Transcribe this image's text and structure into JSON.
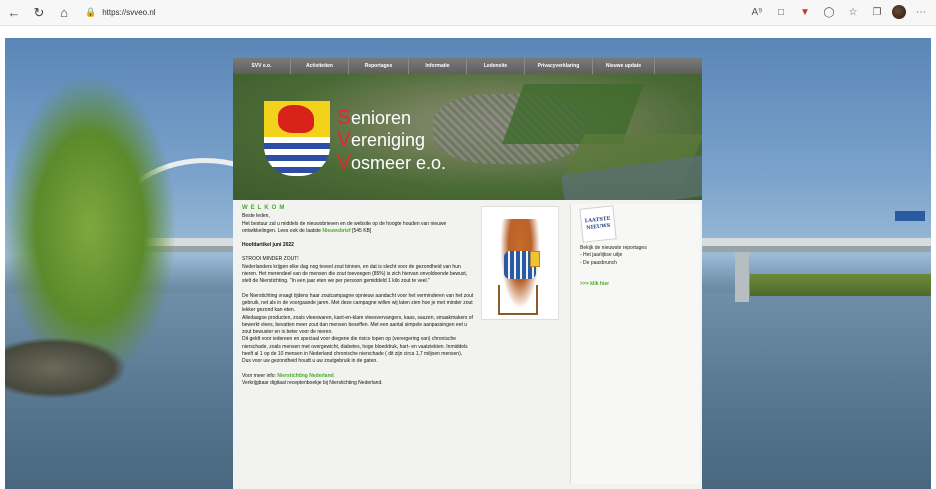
{
  "browser": {
    "url": "https://svveo.nl",
    "icons": [
      "back-icon",
      "refresh-icon",
      "home-icon",
      "lock-icon",
      "read-aloud-icon",
      "tab-icon",
      "extension-icon",
      "circle-icon",
      "favorites-icon",
      "collections-icon",
      "avatar",
      "more-icon"
    ]
  },
  "nav": {
    "items": [
      "SVV e.o.",
      "Activiteiten",
      "Reportages",
      "Informatie",
      "Ledensite",
      "Privacyverklaring",
      "Nieuwe update"
    ]
  },
  "banner": {
    "line1_initial": "S",
    "line1_rest": "enioren",
    "line2_initial": "V",
    "line2_rest": "ereniging",
    "line3_initial": "V",
    "line3_rest": "osmeer e.o."
  },
  "main": {
    "welkom": "WELKOM",
    "p1": "Beste leden,",
    "p2a": "Het bestuur zal u middels de nieuwsbrieven en de website op de hoogte houden van nieuwe ontwikkelingen. Lees ook de laatste ",
    "p2_link": "Nieuwsbrief",
    "p2b": " [545 KB]",
    "heading": "Hoofdartikel juni 2022",
    "sub": "STROOI MINDER ZOUT!",
    "p3": "Nederlanders krijgen elke dag nog teveel zout binnen, en dat is slecht voor de gezondheid van hun nieren. Het merendeel van de mensen die zout toevoegen (85%) is zich hiervan onvoldoende bewust, stelt de Nierstichting. \"In een jaar eten we per persoon gemiddeld 1 kilo zout te veel.\"",
    "p4": "De Nierstichting vraagt tijdens haar zoutcampagne opnieuw aandacht voor het verminderen van het zout gebruik, net als in de voorgaande jaren. Met deze campagne willen wij laten zien hoe je met minder zout lekker gezond kan eten.",
    "p5": "Alledaagse producten, zoals vleeswaren, kant-en-klare vleesvervangers, kaas, sauzen, smaakmakers of bewerkt vlees, bevatten meer zout dan mensen beseffen. Met een aantal simpele aanpassingen eet u zout bewuster en is beter voor de nieren.",
    "p6": "Dit geldt voor iedereen en speciaal voor diegene die risico lopen op (verergering van) chronische nierschade, zoals mensen met overgewicht, diabetes, hoge bloeddruk, hart- en vaatziekten. Inmiddels heeft al 1 op de 10 mensen in Nederland chronische nierschade ( dit zijn circa 1,7 miljoen mensen).",
    "p7": "Dus voor uw gezondheid houdt u uw zoutgebruik in de gaten.",
    "more_label": "Voor meer info: ",
    "more_link": "Nierstichting Nederland",
    "p8": "Verkrijgbaar digitaal receptenboekje bij Nierstichting Nederland."
  },
  "sidebar": {
    "badge_line1": "LAATSTE",
    "badge_line2": "NIEUWS",
    "text1": "Bekijk de nieuwste reportages",
    "text2": "- Het jaarlijkse uitje",
    "text3": "- De paasbrunch",
    "link": ">>> klik hier"
  }
}
